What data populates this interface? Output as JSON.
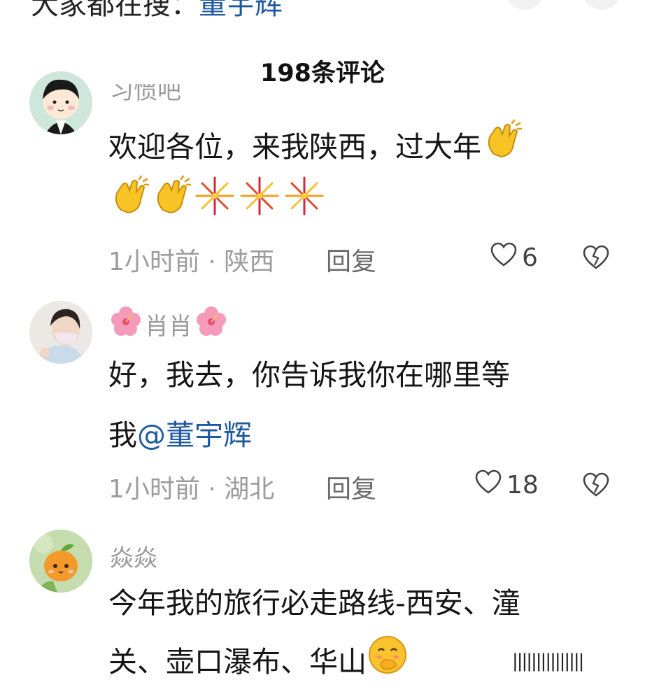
{
  "top": {
    "partial_text": "大家都在搜：",
    "partial_link": "董宇辉"
  },
  "header": {
    "title": "198条评论"
  },
  "comments": [
    {
      "username": "习惯吧",
      "text_line1": "欢迎各位，来我陕西，过大年",
      "time_location": "1小时前 · 陕西",
      "reply_label": "回复",
      "likes": "6"
    },
    {
      "username": "肖肖",
      "text_line1": "好，我去，你告诉我你在哪里等",
      "text_line2_prefix": "我",
      "mention": "@董宇辉",
      "time_location": "1小时前 · 湖北",
      "reply_label": "回复",
      "likes": "18"
    },
    {
      "username": "焱焱",
      "text_line1": "今年我的旅行必走路线-西安、潼",
      "text_line2": "关、壶口瀑布、华山"
    }
  ],
  "watermark": "|||||||||||||||",
  "icons": [
    "heart-outline-icon",
    "broken-heart-icon",
    "clapping-hands-emoji",
    "fireworks-emoji",
    "hibiscus-emoji",
    "giggle-emoji"
  ],
  "colors": {
    "mention": "#1e5aa0",
    "meta": "#9c9c9c",
    "accent_yellow": "#f7c325"
  }
}
